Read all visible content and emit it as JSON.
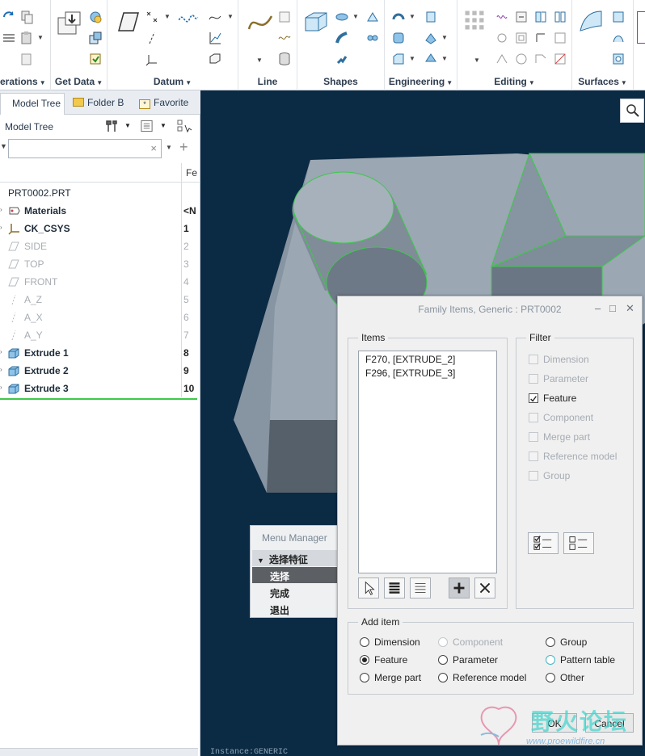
{
  "ribbon": {
    "groups": [
      {
        "label": "erations",
        "has_menu": true
      },
      {
        "label": "Get Data",
        "has_menu": true
      },
      {
        "label": "Datum",
        "has_menu": true
      },
      {
        "label": "Line",
        "has_menu": false
      },
      {
        "label": "Shapes",
        "has_menu": false
      },
      {
        "label": "Engineering",
        "has_menu": true
      },
      {
        "label": "Editing",
        "has_menu": true
      },
      {
        "label": "Surfaces",
        "has_menu": true
      }
    ]
  },
  "left_panel": {
    "tabs": [
      "Model Tree",
      "Folder B",
      "Favorite"
    ],
    "header_title": "Model Tree",
    "search": {
      "value": "",
      "clear": "×"
    },
    "column_header": "Fe",
    "rows": [
      {
        "name": "PRT0002.PRT",
        "num": "",
        "icon": "part-icon",
        "style": "bold"
      },
      {
        "name": "Materials",
        "num": "<N",
        "icon": "materials-icon",
        "style": "bold"
      },
      {
        "name": "CK_CSYS",
        "num": "1",
        "icon": "csys-icon",
        "style": "bold"
      },
      {
        "name": "SIDE",
        "num": "2",
        "icon": "datum-plane-icon",
        "style": "dim"
      },
      {
        "name": "TOP",
        "num": "3",
        "icon": "datum-plane-icon",
        "style": "dim"
      },
      {
        "name": "FRONT",
        "num": "4",
        "icon": "datum-plane-icon",
        "style": "dim"
      },
      {
        "name": "A_Z",
        "num": "5",
        "icon": "datum-axis-icon",
        "style": "dim"
      },
      {
        "name": "A_X",
        "num": "6",
        "icon": "datum-axis-icon",
        "style": "dim"
      },
      {
        "name": "A_Y",
        "num": "7",
        "icon": "datum-axis-icon",
        "style": "dim"
      },
      {
        "name": "Extrude 1",
        "num": "8",
        "icon": "extrude-icon",
        "style": "bold"
      },
      {
        "name": "Extrude 2",
        "num": "9",
        "icon": "extrude-icon",
        "style": "bold"
      },
      {
        "name": "Extrude 3",
        "num": "10",
        "icon": "extrude-icon",
        "style": "bold"
      }
    ]
  },
  "menu_manager": {
    "title": "Menu Manager",
    "header": "选择特征",
    "items": [
      "选择",
      "完成",
      "退出"
    ],
    "selected_index": 0
  },
  "dialog": {
    "title": "Family Items,  Generic : PRT0002",
    "items_label": "Items",
    "items": [
      "F270, [EXTRUDE_2]",
      "F296, [EXTRUDE_3]"
    ],
    "filter_label": "Filter",
    "filters": [
      {
        "label": "Dimension",
        "checked": false
      },
      {
        "label": "Parameter",
        "checked": false
      },
      {
        "label": "Feature",
        "checked": true
      },
      {
        "label": "Component",
        "checked": false
      },
      {
        "label": "Merge part",
        "checked": false
      },
      {
        "label": "Reference model",
        "checked": false
      },
      {
        "label": "Group",
        "checked": false
      }
    ],
    "add_item_label": "Add item",
    "add_options": [
      {
        "label": "Dimension",
        "selected": false,
        "enabled": true
      },
      {
        "label": "Component",
        "selected": false,
        "enabled": false
      },
      {
        "label": "Group",
        "selected": false,
        "enabled": true
      },
      {
        "label": "Feature",
        "selected": true,
        "enabled": true
      },
      {
        "label": "Parameter",
        "selected": false,
        "enabled": true
      },
      {
        "label": "Pattern table",
        "selected": false,
        "enabled": true
      },
      {
        "label": "Merge part",
        "selected": false,
        "enabled": true
      },
      {
        "label": "Reference model",
        "selected": false,
        "enabled": true
      },
      {
        "label": "Other",
        "selected": false,
        "enabled": true
      }
    ],
    "ok_label": "OK",
    "cancel_label": "Cancel"
  },
  "watermark": {
    "cn": "野火论坛",
    "url": "www.proewildfire.cn"
  },
  "status_text": "Instance:GENERIC",
  "colors": {
    "accent_green": "#3cc94a",
    "viewport_bg": "#0b2a44",
    "model_gray": "#9ba7b3"
  }
}
